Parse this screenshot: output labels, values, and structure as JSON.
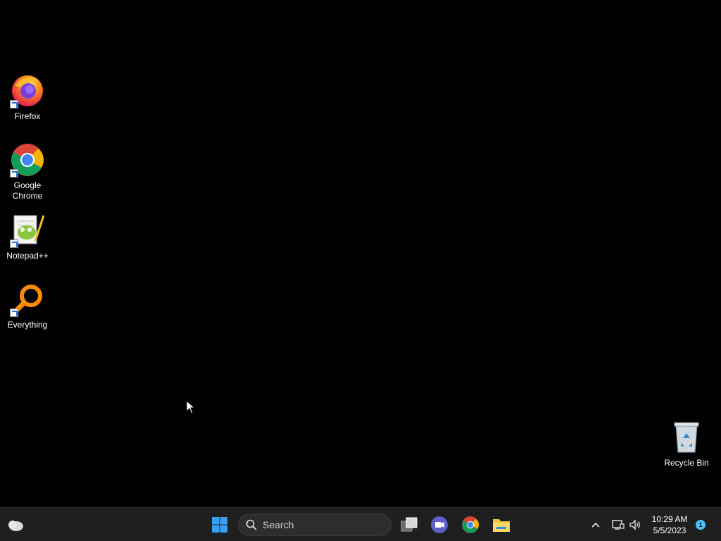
{
  "desktop": {
    "icons": [
      {
        "label": "Firefox",
        "icon": "firefox-icon"
      },
      {
        "label": "Google Chrome",
        "icon": "chrome-icon"
      },
      {
        "label": "Notepad++",
        "icon": "notepadpp-icon"
      },
      {
        "label": "Everything",
        "icon": "everything-icon"
      }
    ],
    "recycle_bin": {
      "label": "Recycle Bin",
      "icon": "recycle-bin-icon"
    }
  },
  "taskbar": {
    "widgets_icon": "weather-icon",
    "start_icon": "windows-start-icon",
    "search": {
      "text": "Search",
      "icon": "search-icon"
    },
    "pinned": [
      {
        "icon": "task-view-icon"
      },
      {
        "icon": "teams-chat-icon"
      },
      {
        "icon": "chrome-icon"
      },
      {
        "icon": "file-explorer-icon"
      }
    ],
    "tray": {
      "chevron_icon": "chevron-up-icon",
      "network_icon": "network-icon",
      "volume_icon": "volume-icon",
      "time": "10:29 AM",
      "date": "5/5/2023",
      "notification_count": "1"
    }
  },
  "colors": {
    "desktop_bg": "#000000",
    "taskbar_bg": "#1f1f1f",
    "accent": "#4cc2ff"
  }
}
